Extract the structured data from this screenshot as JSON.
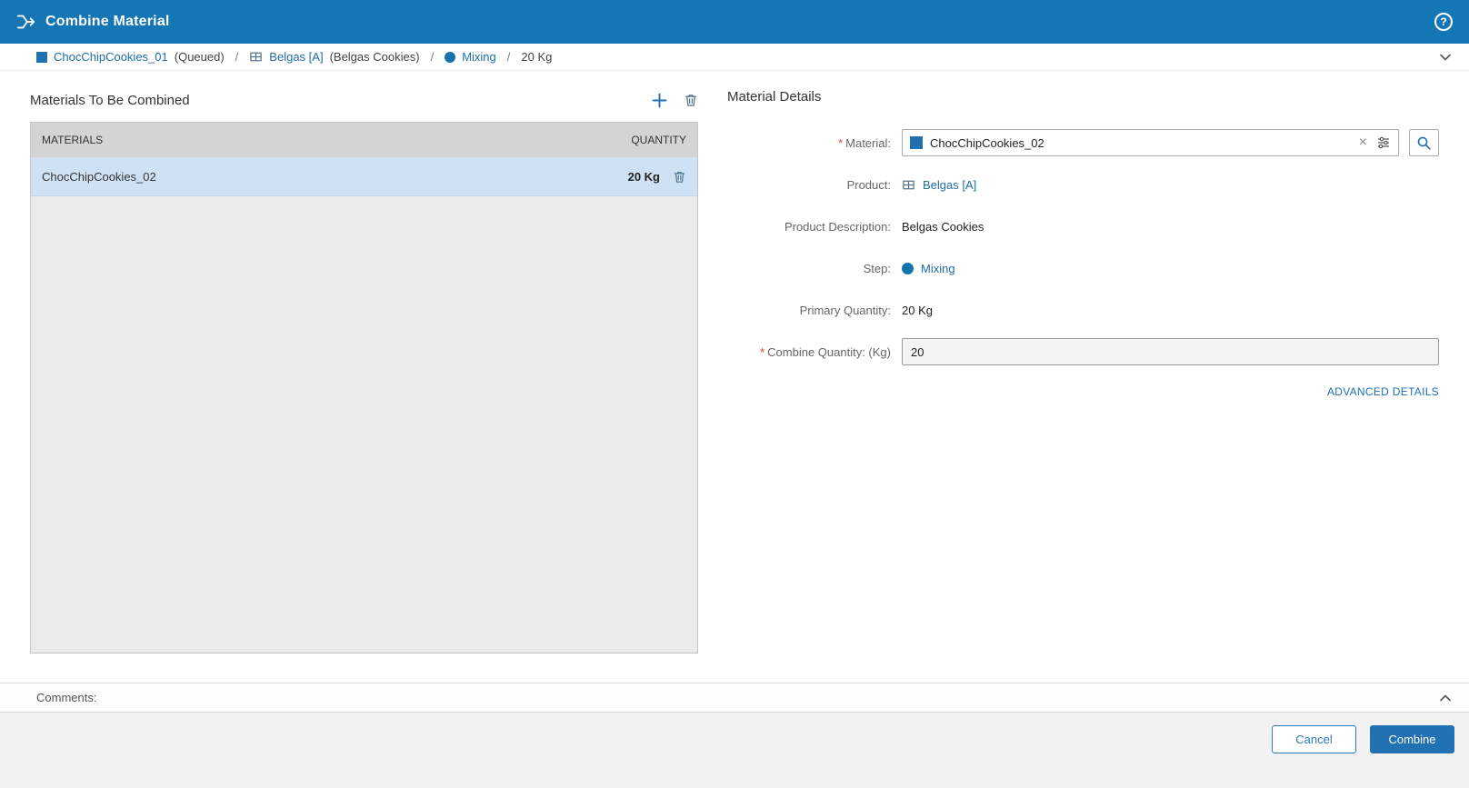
{
  "header": {
    "title": "Combine Material",
    "help_label": "?"
  },
  "breadcrumb": {
    "separator": "/",
    "material": {
      "name": "ChocChipCookies_01",
      "status": "(Queued)"
    },
    "product": {
      "name": "Belgas [A]",
      "description": "(Belgas Cookies)"
    },
    "step": {
      "name": "Mixing"
    },
    "quantity": "20 Kg"
  },
  "left_panel": {
    "title": "Materials To Be Combined",
    "table": {
      "headers": [
        "MATERIALS",
        "QUANTITY"
      ],
      "rows": [
        {
          "material": "ChocChipCookies_02",
          "quantity": "20 Kg"
        }
      ]
    }
  },
  "details": {
    "title": "Material Details",
    "material": {
      "required": "*",
      "label": "Material:",
      "value": "ChocChipCookies_02",
      "clear": "×"
    },
    "product": {
      "label": "Product:",
      "value": "Belgas [A]"
    },
    "product_description": {
      "label": "Product Description:",
      "value": "Belgas Cookies"
    },
    "step": {
      "label": "Step:",
      "value": "Mixing"
    },
    "primary_quantity": {
      "label": "Primary Quantity:",
      "value": "20 Kg"
    },
    "combine_quantity": {
      "required": "*",
      "label": "Combine Quantity: (Kg)",
      "value": "20"
    },
    "advanced_link": "ADVANCED DETAILS"
  },
  "comments": {
    "label": "Comments:"
  },
  "footer": {
    "cancel_label": "Cancel",
    "combine_label": "Combine"
  },
  "colors": {
    "header_bg": "#1476b4",
    "link": "#1e6ea5",
    "accent": "#2271b3",
    "selected_row_bg": "#cfe2f4",
    "table_header_bg": "#d4d4d4",
    "required": "#d04437"
  }
}
